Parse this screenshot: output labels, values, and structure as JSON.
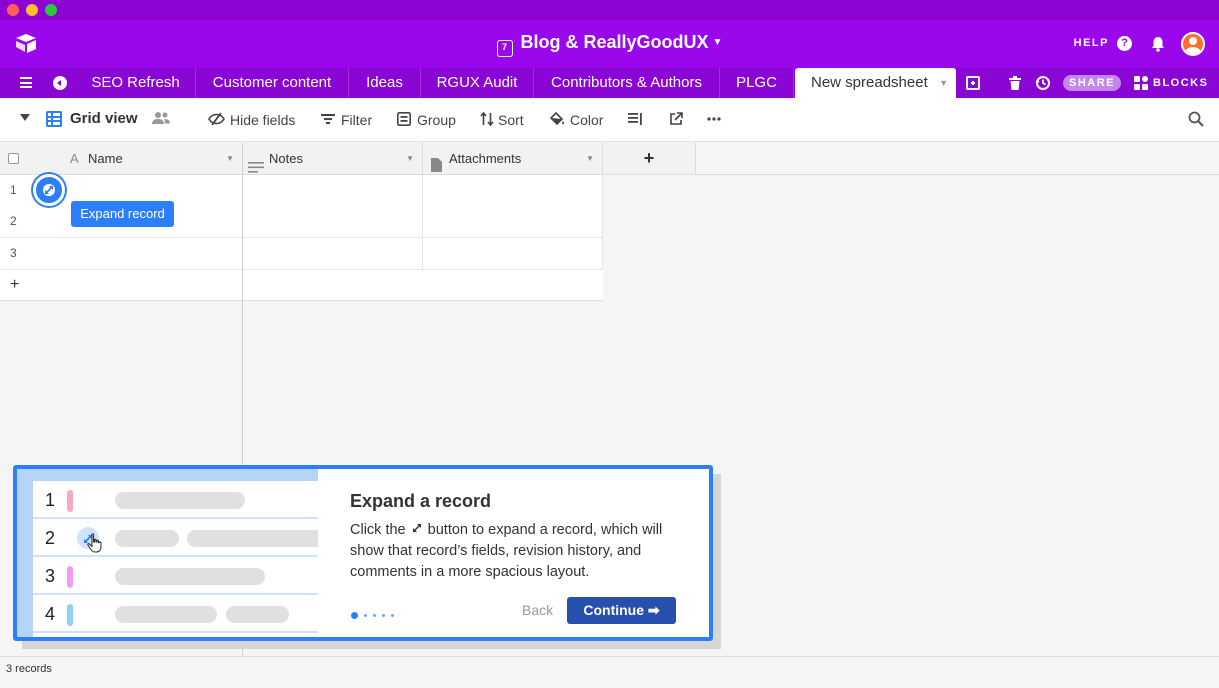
{
  "window": {
    "title": ""
  },
  "header": {
    "base_name": "Blog & ReallyGoodUX",
    "calendar_day": "7",
    "help_label": "HELP"
  },
  "tabs": [
    {
      "label": "SEO Refresh"
    },
    {
      "label": "Customer content"
    },
    {
      "label": "Ideas"
    },
    {
      "label": "RGUX Audit"
    },
    {
      "label": "Contributors & Authors"
    },
    {
      "label": "PLGC"
    },
    {
      "label": "New spreadsheet",
      "active": true
    }
  ],
  "actions": {
    "share_label": "SHARE",
    "blocks_label": "BLOCKS"
  },
  "toolbar": {
    "view_name": "Grid view",
    "hide_fields": "Hide fields",
    "filter": "Filter",
    "group": "Group",
    "sort": "Sort",
    "color": "Color"
  },
  "grid": {
    "columns": [
      "Name",
      "Notes",
      "Attachments"
    ],
    "add_column": "+",
    "rows": [
      "1",
      "2",
      "3"
    ],
    "add_row": "+"
  },
  "tooltip": {
    "text": "Expand record"
  },
  "footer": {
    "record_count": "3 records"
  },
  "onboarding": {
    "title": "Expand a record",
    "body_before": "Click the",
    "body_after": "button to expand a record, which will show that record’s fields, revision history, and comments in a more spacious layout.",
    "back_label": "Back",
    "continue_label": "Continue ➡",
    "step_current": 1,
    "step_total": 5,
    "illustration_rows": [
      "1",
      "2",
      "3",
      "4"
    ]
  },
  "colors": {
    "header_bg": "#9a07ec",
    "tabs_bg": "#8a06d4",
    "accent_blue": "#2d7ff9",
    "continue_bg": "#2750ae"
  }
}
